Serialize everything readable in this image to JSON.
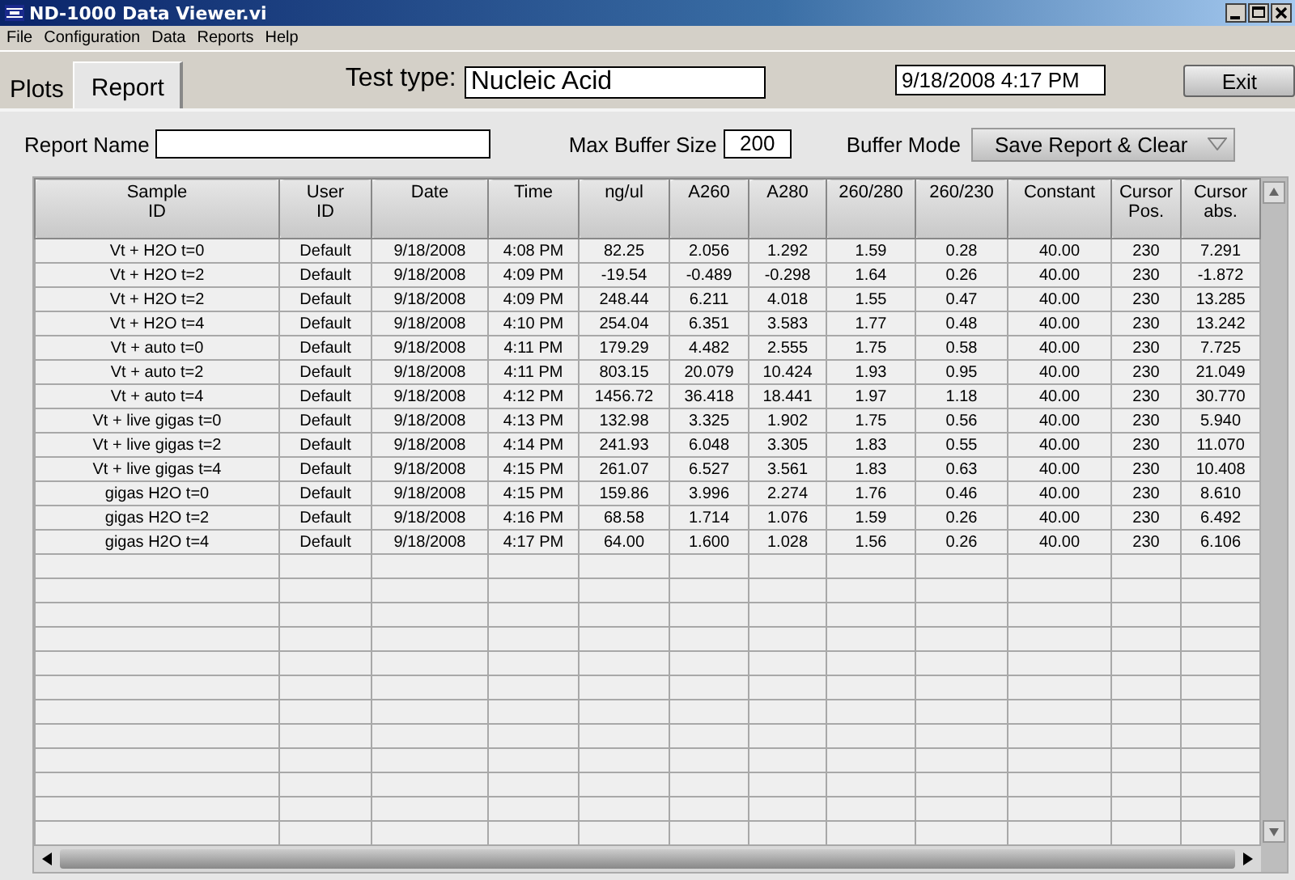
{
  "window": {
    "title": "ND-1000 Data Viewer.vi"
  },
  "menu": [
    "File",
    "Configuration",
    "Data",
    "Reports",
    "Help"
  ],
  "tabs": [
    {
      "label": "Plots",
      "selected": false
    },
    {
      "label": "Report",
      "selected": true
    }
  ],
  "test_type": {
    "label": "Test type:",
    "value": "Nucleic Acid"
  },
  "datetime": "9/18/2008  4:17 PM",
  "exit_button": "Exit",
  "report_name": {
    "label": "Report Name"
  },
  "max_buffer_size": {
    "label": "Max Buffer Size",
    "value": "200"
  },
  "buffer_mode": {
    "label": "Buffer Mode",
    "value": "Save Report & Clear"
  },
  "table": {
    "columns": [
      "Sample\nID",
      "User\nID",
      "Date",
      "Time",
      "ng/ul",
      "A260",
      "A280",
      "260/280",
      "260/230",
      "Constant",
      "Cursor\nPos.",
      "Cursor\nabs."
    ],
    "rows": [
      [
        "Vt + H2O t=0",
        "Default",
        "9/18/2008",
        "4:08 PM",
        "82.25",
        "2.056",
        "1.292",
        "1.59",
        "0.28",
        "40.00",
        "230",
        "7.291"
      ],
      [
        "Vt + H2O t=2",
        "Default",
        "9/18/2008",
        "4:09 PM",
        "-19.54",
        "-0.489",
        "-0.298",
        "1.64",
        "0.26",
        "40.00",
        "230",
        "-1.872"
      ],
      [
        "Vt + H2O t=2",
        "Default",
        "9/18/2008",
        "4:09 PM",
        "248.44",
        "6.211",
        "4.018",
        "1.55",
        "0.47",
        "40.00",
        "230",
        "13.285"
      ],
      [
        "Vt + H2O t=4",
        "Default",
        "9/18/2008",
        "4:10 PM",
        "254.04",
        "6.351",
        "3.583",
        "1.77",
        "0.48",
        "40.00",
        "230",
        "13.242"
      ],
      [
        "Vt + auto t=0",
        "Default",
        "9/18/2008",
        "4:11 PM",
        "179.29",
        "4.482",
        "2.555",
        "1.75",
        "0.58",
        "40.00",
        "230",
        "7.725"
      ],
      [
        "Vt + auto t=2",
        "Default",
        "9/18/2008",
        "4:11 PM",
        "803.15",
        "20.079",
        "10.424",
        "1.93",
        "0.95",
        "40.00",
        "230",
        "21.049"
      ],
      [
        "Vt + auto t=4",
        "Default",
        "9/18/2008",
        "4:12 PM",
        "1456.72",
        "36.418",
        "18.441",
        "1.97",
        "1.18",
        "40.00",
        "230",
        "30.770"
      ],
      [
        "Vt + live gigas t=0",
        "Default",
        "9/18/2008",
        "4:13 PM",
        "132.98",
        "3.325",
        "1.902",
        "1.75",
        "0.56",
        "40.00",
        "230",
        "5.940"
      ],
      [
        "Vt + live gigas t=2",
        "Default",
        "9/18/2008",
        "4:14 PM",
        "241.93",
        "6.048",
        "3.305",
        "1.83",
        "0.55",
        "40.00",
        "230",
        "11.070"
      ],
      [
        "Vt + live gigas t=4",
        "Default",
        "9/18/2008",
        "4:15 PM",
        "261.07",
        "6.527",
        "3.561",
        "1.83",
        "0.63",
        "40.00",
        "230",
        "10.408"
      ],
      [
        "gigas H2O t=0",
        "Default",
        "9/18/2008",
        "4:15 PM",
        "159.86",
        "3.996",
        "2.274",
        "1.76",
        "0.46",
        "40.00",
        "230",
        "8.610"
      ],
      [
        "gigas H2O t=2",
        "Default",
        "9/18/2008",
        "4:16 PM",
        "68.58",
        "1.714",
        "1.076",
        "1.59",
        "0.26",
        "40.00",
        "230",
        "6.492"
      ],
      [
        "gigas H2O t=4",
        "Default",
        "9/18/2008",
        "4:17 PM",
        "64.00",
        "1.600",
        "1.028",
        "1.56",
        "0.26",
        "40.00",
        "230",
        "6.106"
      ]
    ]
  }
}
